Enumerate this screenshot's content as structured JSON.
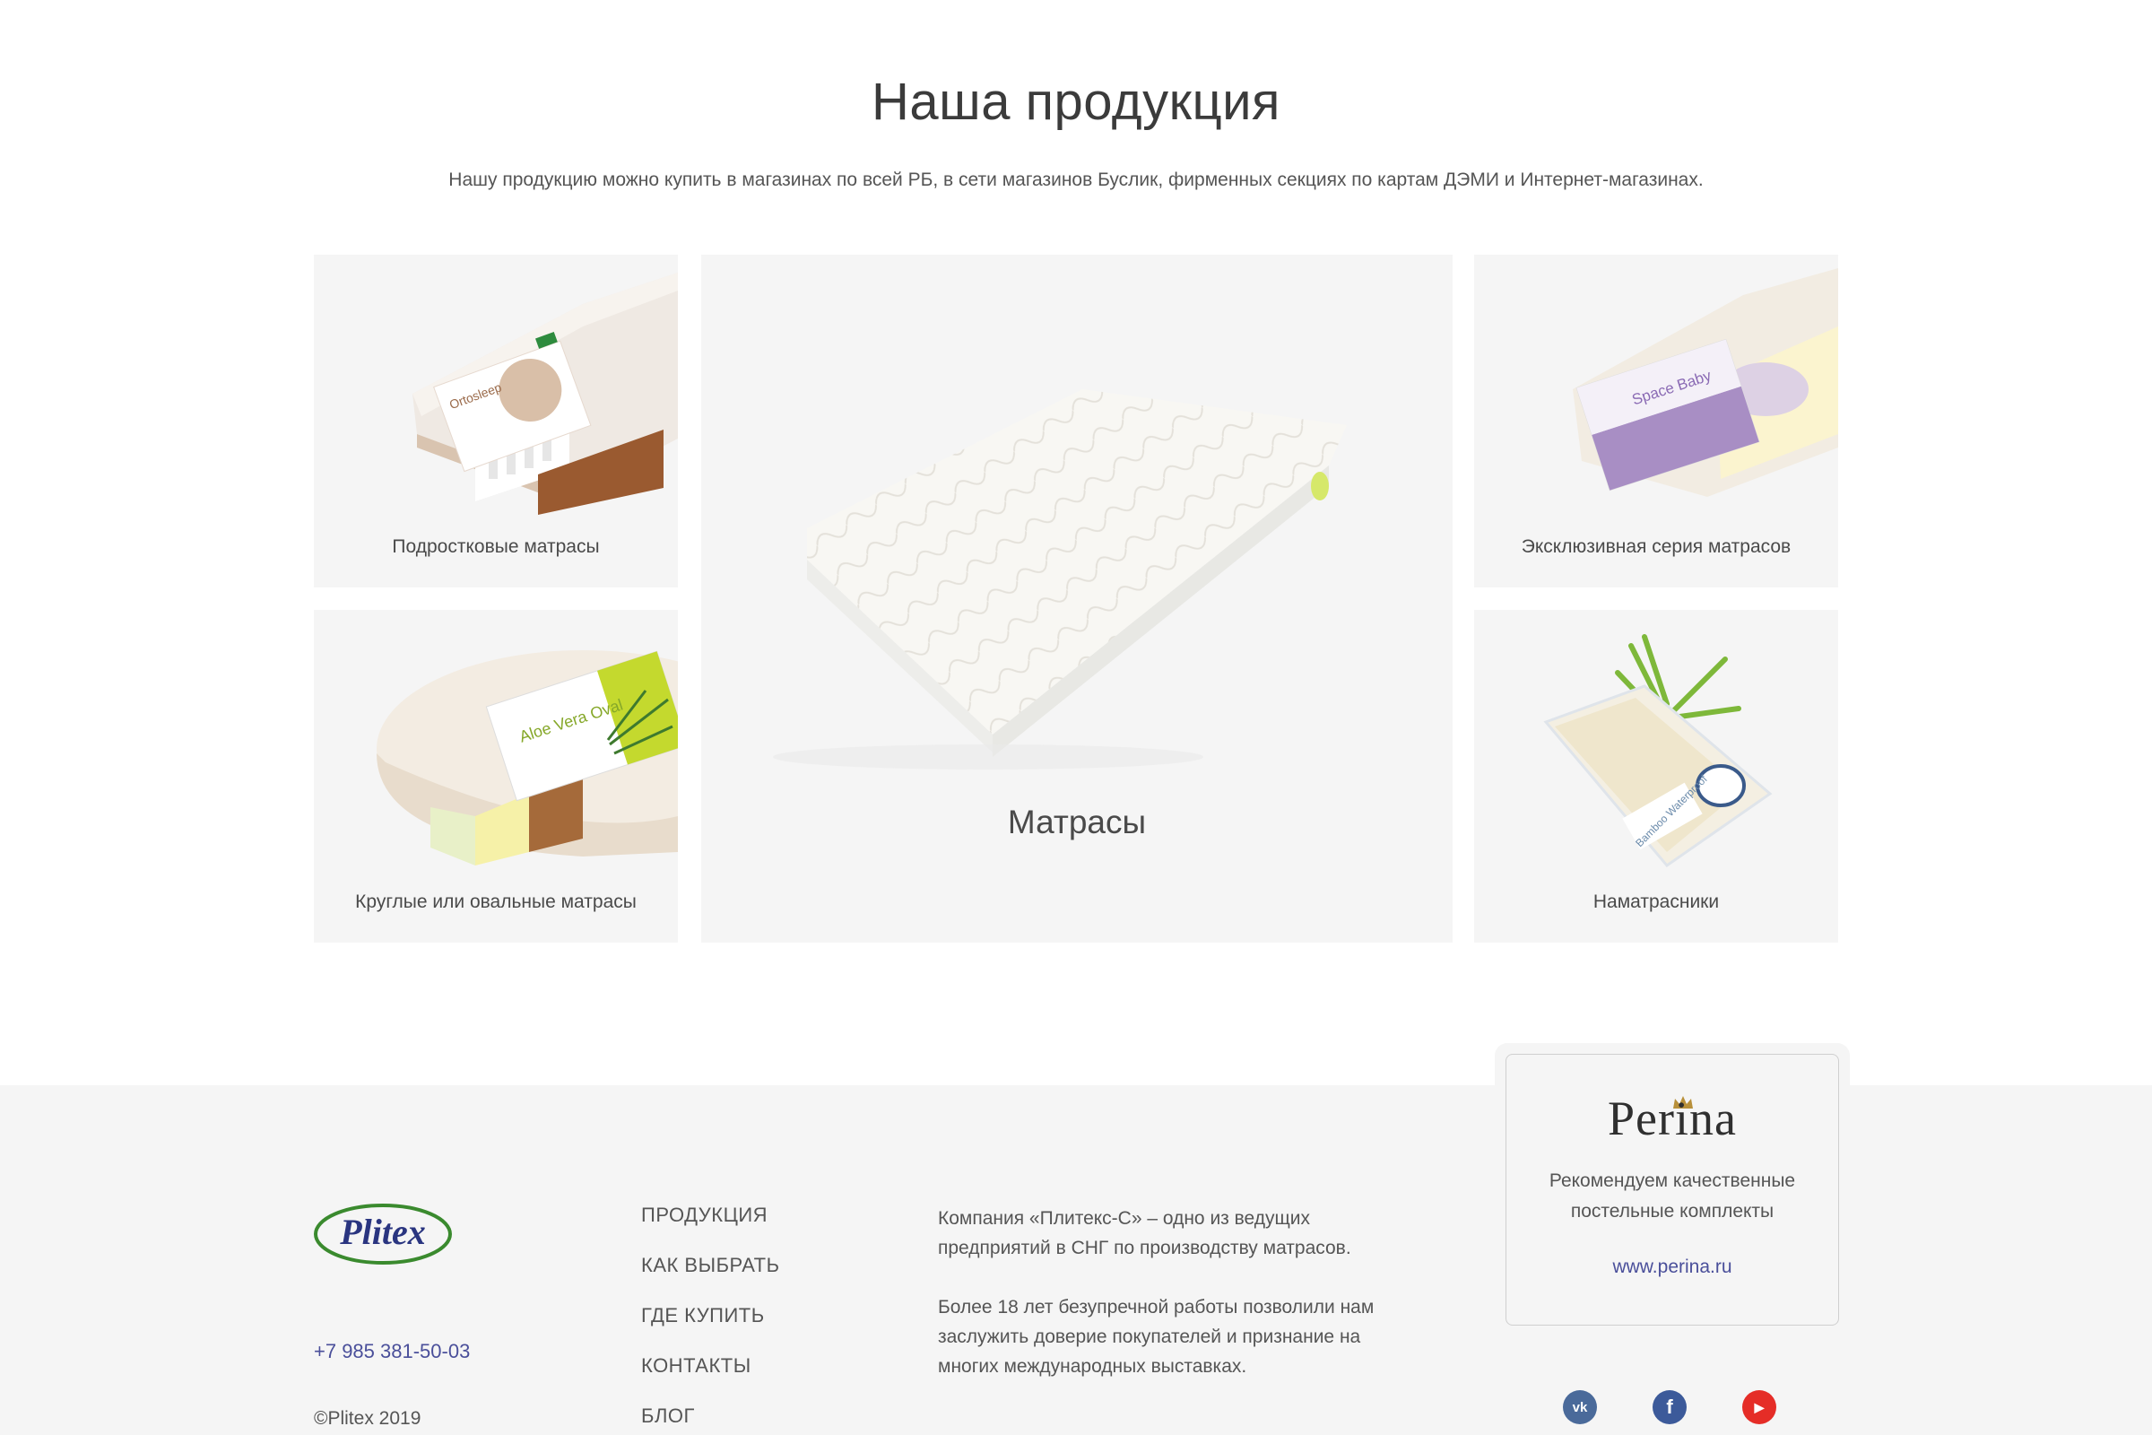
{
  "products": {
    "title": "Наша продукция",
    "subtitle": "Нашу продукцию можно купить в магазинах по всей РБ, в сети магазинов Буслик, фирменных секциях по картам ДЭМИ и Интернет-магазинах.",
    "cards": {
      "teen": {
        "label": "Подростковые матрасы",
        "product_brand": "Ortosleep"
      },
      "mattress": {
        "label": "Матрасы"
      },
      "exclusive": {
        "label": "Эксклюзивная серия матрасов",
        "product_brand": "Space Baby"
      },
      "round": {
        "label": "Круглые или овальные матрасы",
        "product_brand": "Aloe Vera Oval"
      },
      "cover": {
        "label": "Наматрасники",
        "product_brand": "Bamboo Waterproof"
      }
    }
  },
  "footer": {
    "logo_text": "Plitex",
    "phone": "+7 985 381-50-03",
    "copyright": "©Plitex 2019",
    "nav": [
      "ПРОДУКЦИЯ",
      "КАК ВЫБРАТЬ",
      "ГДЕ КУПИТЬ",
      "КОНТАКТЫ",
      "БЛОГ"
    ],
    "about": [
      "Компания «Плитекс-С» – одно из ведущих предприятий в СНГ по производству матрасов.",
      "Более 18 лет безупречной работы позволили нам заслужить доверие покупателей и признание на многих международных выставках."
    ],
    "perina": {
      "logo_text": "Perina",
      "text": "Рекомендуем качественные постельные комплекты",
      "link": "www.perina.ru"
    },
    "social": [
      {
        "name": "vk",
        "icon": "vk-icon",
        "color": "#4a6a9a",
        "glyph": "vk"
      },
      {
        "name": "facebook",
        "icon": "facebook-icon",
        "color": "#3c5a9a",
        "glyph": "f"
      },
      {
        "name": "youtube",
        "icon": "youtube-icon",
        "color": "#e52d27",
        "glyph": "▶"
      }
    ]
  },
  "colors": {
    "link": "#4a4f9a",
    "card_bg": "#f5f5f5",
    "logo_green": "#3a8a2e",
    "logo_blue": "#2a3580"
  }
}
